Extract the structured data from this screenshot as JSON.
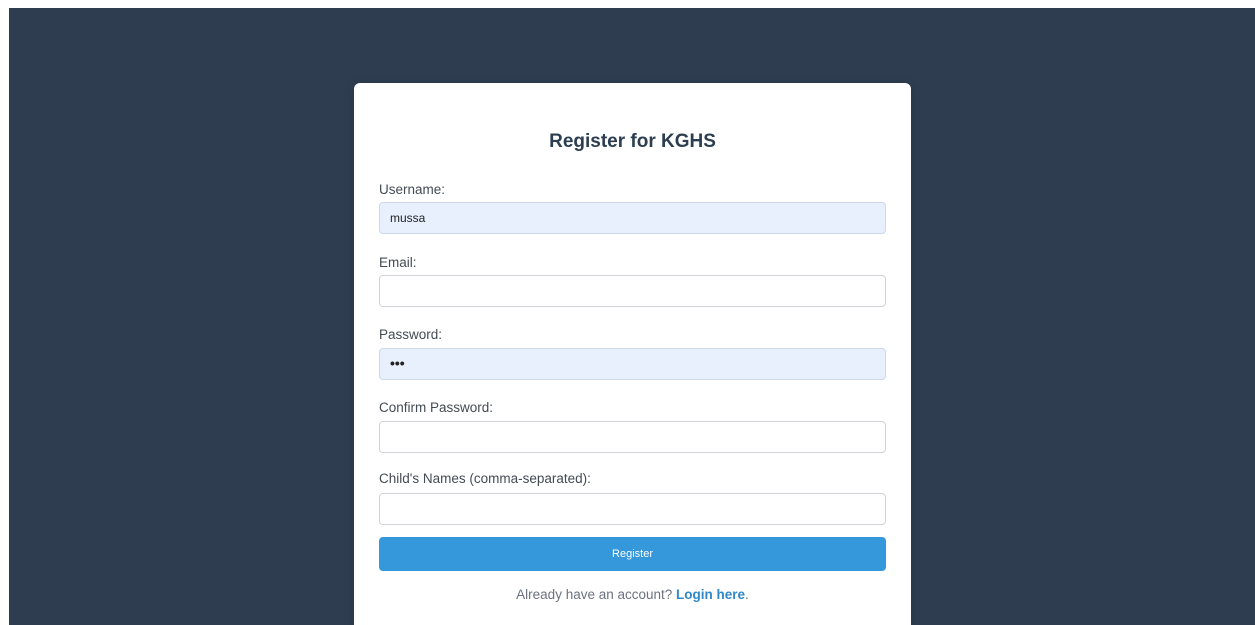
{
  "form": {
    "title": "Register for KGHS",
    "fields": [
      {
        "label": "Username:",
        "value": "mussa",
        "autofilled": true
      },
      {
        "label": "Email:",
        "value": ""
      },
      {
        "label": "Password:",
        "value": "•••",
        "autofilled": true
      },
      {
        "label": "Confirm Password:",
        "value": ""
      },
      {
        "label": "Child's Names (comma-separated):",
        "value": ""
      }
    ],
    "submit_label": "Register",
    "footer": {
      "prompt": "Already have an account? ",
      "link_label": "Login here",
      "suffix": "."
    }
  },
  "colors": {
    "page_background": "#2e3d50",
    "accent": "#3498db",
    "autofill_background": "#e8effd"
  }
}
